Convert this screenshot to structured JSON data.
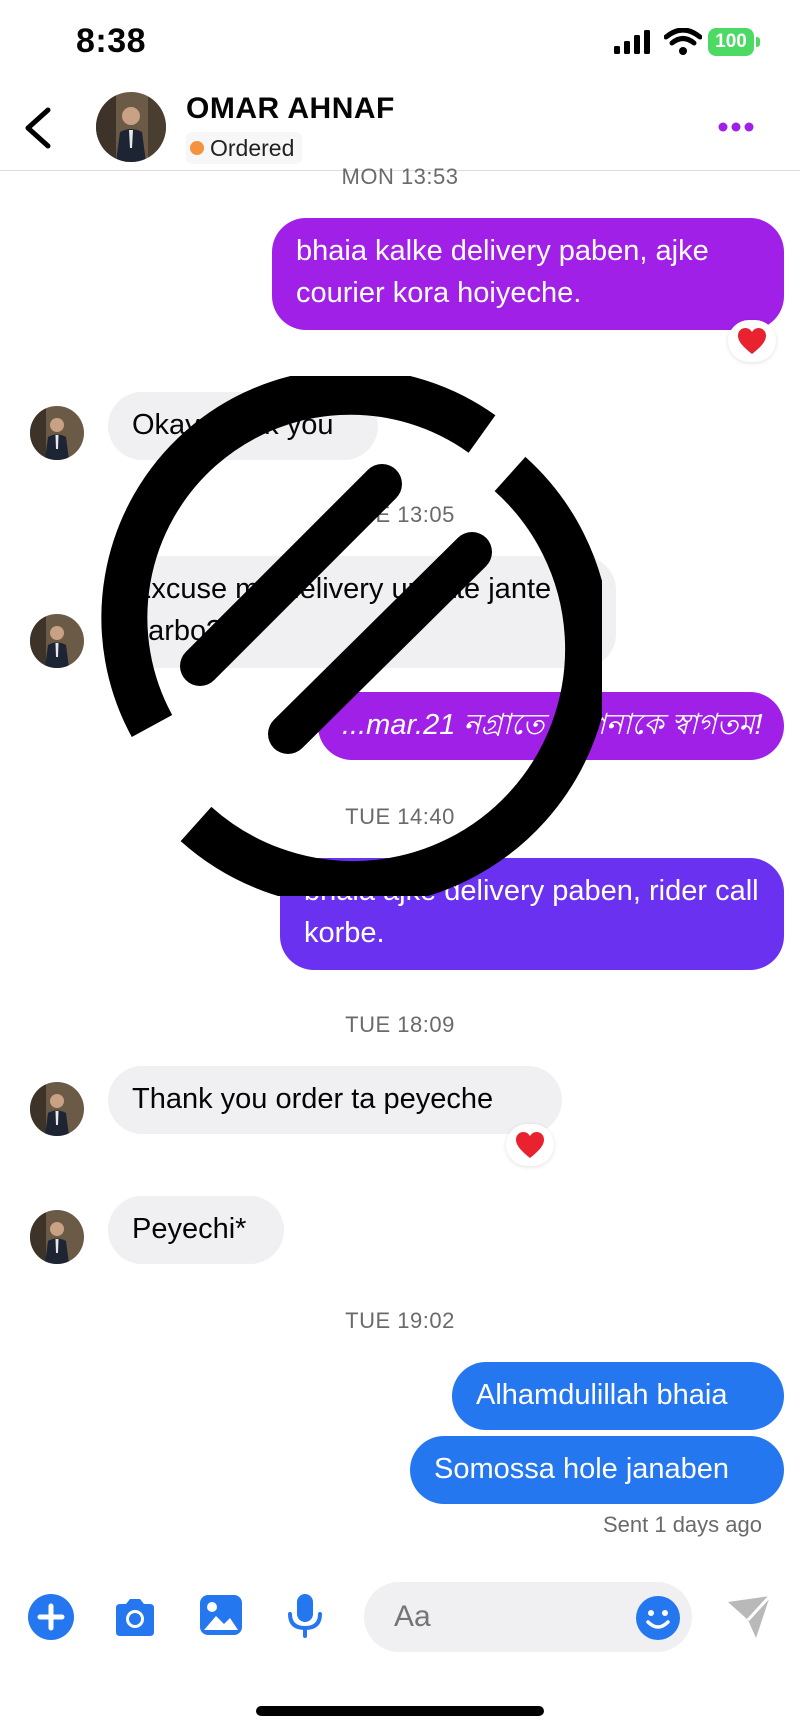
{
  "status_bar": {
    "time": "8:38",
    "battery": "100"
  },
  "header": {
    "name": "OMAR AHNAF",
    "status": "Ordered"
  },
  "timestamps": {
    "t1": "MON 13:53",
    "t2": "TUE 13:05",
    "t3": "TUE 14:40",
    "t4": "TUE 18:09",
    "t5": "TUE 19:02"
  },
  "messages": {
    "m1": "bhaia kalke delivery paben, ajke courier kora hoiyeche.",
    "m2": "Okay thank you",
    "m3": "Excuse me delivery update jante parbo?",
    "m4": "...mar.21 নগ্রাতে আপনাকে স্বাগতম!",
    "m5": "bhaia ajke delivery paben, rider call korbe.",
    "m6": "Thank you order ta peyeche",
    "m7": "Peyechi*",
    "m8": "Alhamdulillah bhaia",
    "m9": "Somossa hole janaben"
  },
  "reactions": {
    "heart": "❤️"
  },
  "sent_status": "Sent 1 days ago",
  "composer": {
    "placeholder": "Aa"
  },
  "icons": [
    "back-icon",
    "more-icon",
    "plus-icon",
    "camera-icon",
    "gallery-icon",
    "microphone-icon",
    "emoji-icon",
    "send-icon",
    "heart-icon"
  ],
  "colors": {
    "accent_blue": "#2477ef",
    "purple": "#a020e8",
    "violet": "#6a32f0",
    "incoming": "#f0f0f2",
    "status_dot": "#f5923e"
  }
}
